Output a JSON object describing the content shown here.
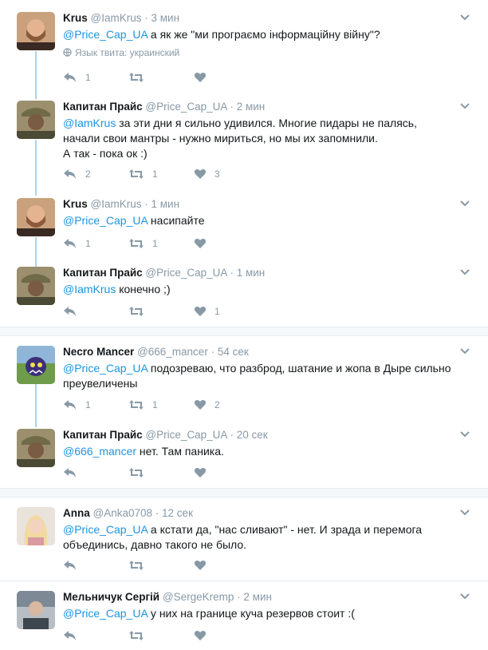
{
  "tweets": [
    {
      "name": "Krus",
      "handle": "@IamKrus",
      "time": "· 3 мин",
      "mention": "@Price_Cap_UA",
      "text": " а як же \"ми програємо інформаційну війну\"?",
      "lang": "Язык твита: украинский",
      "reply": "1",
      "retweet": "",
      "like": ""
    },
    {
      "name": "Капитан Прайс",
      "handle": "@Price_Cap_UA",
      "time": "· 2 мин",
      "mention": "@IamKrus",
      "text": " за эти дни я сильно удивился. Многие пидары не палясь, начали свои мантры - нужно мириться, но мы их запомнили.",
      "text2": "А так - пока ок :)",
      "reply": "2",
      "retweet": "1",
      "like": "3"
    },
    {
      "name": "Krus",
      "handle": "@IamKrus",
      "time": "· 1 мин",
      "mention": "@Price_Cap_UA",
      "text": " насипайте",
      "reply": "1",
      "retweet": "1",
      "like": ""
    },
    {
      "name": "Капитан Прайс",
      "handle": "@Price_Cap_UA",
      "time": "· 1 мин",
      "mention": "@IamKrus",
      "text": " конечно ;)",
      "reply": "",
      "retweet": "",
      "like": "1"
    },
    {
      "name": "Necro Mancer",
      "handle": "@666_mancer",
      "time": "· 54 сек",
      "mention": "@Price_Cap_UA",
      "text": " подозреваю, что разброд, шатание и жопа в Дыре сильно преувеличены",
      "reply": "1",
      "retweet": "1",
      "like": "2"
    },
    {
      "name": "Капитан Прайс",
      "handle": "@Price_Cap_UA",
      "time": "· 20 сек",
      "mention": "@666_mancer",
      "text": " нет. Там паника.",
      "reply": "",
      "retweet": "",
      "like": ""
    },
    {
      "name": "Anna",
      "handle": "@Anka0708",
      "time": "· 12 сек",
      "mention": "@Price_Cap_UA",
      "text": " а кстати да, \"нас сливают\" - нет. И зрада и перемога объединись, давно такого не было.",
      "reply": "",
      "retweet": "",
      "like": ""
    },
    {
      "name": "Мельничук Сергій",
      "handle": "@SergeKremp",
      "time": "· 2 мин",
      "mention": "@Price_Cap_UA",
      "text": " у них на границе куча резервов стоит :(",
      "reply": "",
      "retweet": "",
      "like": ""
    }
  ],
  "colors": {
    "link": "#1b95e0",
    "muted": "#8899a6",
    "thread": "#a9d3ee",
    "text": "#14171a"
  }
}
